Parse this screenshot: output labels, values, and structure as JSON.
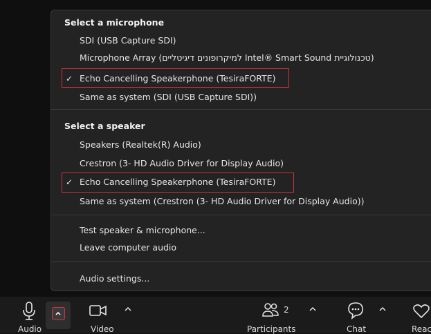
{
  "menu": {
    "mic_title": "Select a microphone",
    "mic_items": [
      "SDI (USB Capture SDI)",
      "Microphone Array (למיקרופונים דיגיטליים Intel® Smart Sound טכנולוגיית)",
      "Echo Cancelling Speakerphone (TesiraFORTE)",
      "Same as system (SDI (USB Capture SDI))"
    ],
    "speaker_title": "Select a speaker",
    "speaker_items": [
      "Speakers (Realtek(R) Audio)",
      "Crestron (3- HD Audio Driver for Display Audio)",
      "Echo Cancelling Speakerphone (TesiraFORTE)",
      "Same as system (Crestron (3- HD Audio Driver for Display Audio))"
    ],
    "test_label": "Test speaker & microphone...",
    "leave_label": "Leave computer audio",
    "settings_label": "Audio settings...",
    "checkmark": "✓"
  },
  "toolbar": {
    "audio_label": "Audio",
    "video_label": "Video",
    "participants_label": "Participants",
    "participants_count": "2",
    "chat_label": "Chat",
    "react_label": "Reac"
  },
  "colors": {
    "highlight": "#d6323a",
    "menu_bg": "#232323",
    "toolbar_bg": "#1b1b1b"
  }
}
